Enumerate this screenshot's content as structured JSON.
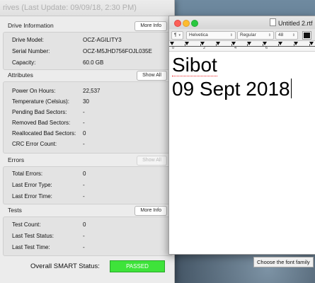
{
  "drive_window": {
    "title": "rives (Last Update: 09/09/18, 2:30 PM)",
    "drive_information": {
      "title": "Drive Information",
      "button": "More Info",
      "rows": [
        {
          "label": "Drive Model:",
          "value": "OCZ-AGILITY3"
        },
        {
          "label": "Serial Number:",
          "value": "OCZ-M5JHD756FOJL035E"
        },
        {
          "label": "Capacity:",
          "value": "60.0 GB"
        }
      ]
    },
    "attributes": {
      "title": "Attributes",
      "button": "Show All",
      "rows": [
        {
          "label": "Power On Hours:",
          "value": "22,537"
        },
        {
          "label": "Temperature (Celsius):",
          "value": "30"
        },
        {
          "label": "Pending Bad Sectors:",
          "value": "-"
        },
        {
          "label": "Removed Bad Sectors:",
          "value": "-"
        },
        {
          "label": "Reallocated Bad Sectors:",
          "value": "0"
        },
        {
          "label": "CRC Error Count:",
          "value": "-"
        }
      ]
    },
    "errors": {
      "title": "Errors",
      "button": "Show All",
      "rows": [
        {
          "label": "Total Errors:",
          "value": "0"
        },
        {
          "label": "Last Error Type:",
          "value": "-"
        },
        {
          "label": "Last Error Time:",
          "value": "-"
        }
      ]
    },
    "tests": {
      "title": "Tests",
      "button": "More Info",
      "rows": [
        {
          "label": "Test Count:",
          "value": "0"
        },
        {
          "label": "Last Test Status:",
          "value": "-"
        },
        {
          "label": "Last Test Time:",
          "value": "-"
        }
      ]
    },
    "overall_status_label": "Overall SMART Status:",
    "overall_status_value": "PASSED",
    "status_color": "#3ee33a"
  },
  "textedit": {
    "title": "Untitled 2.rtf",
    "toolbar": {
      "paragraph": "¶",
      "font": "Helvetica",
      "style": "Regular",
      "size": "48"
    },
    "ruler_numbers": [
      "0",
      "2",
      "4",
      "6"
    ],
    "doc_line1": "Sibot",
    "doc_line2": "09 Sept 2018"
  },
  "tooltip": "Choose the font family"
}
